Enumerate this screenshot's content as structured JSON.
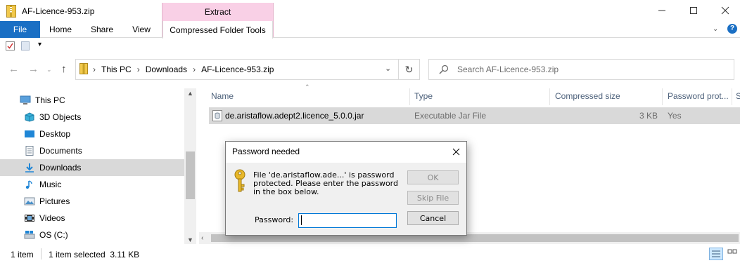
{
  "window": {
    "title": "AF-Licence-953.zip"
  },
  "ribbon": {
    "context_group": "Extract",
    "tabs": [
      "File",
      "Home",
      "Share",
      "View",
      "Compressed Folder Tools"
    ]
  },
  "address_bar": {
    "crumbs": [
      "This PC",
      "Downloads",
      "AF-Licence-953.zip"
    ],
    "search_placeholder": "Search AF-Licence-953.zip"
  },
  "nav_pane": {
    "items": [
      {
        "label": "This PC",
        "icon": "computer-icon"
      },
      {
        "label": "3D Objects",
        "icon": "cube-icon"
      },
      {
        "label": "Desktop",
        "icon": "desktop-icon"
      },
      {
        "label": "Documents",
        "icon": "document-icon"
      },
      {
        "label": "Downloads",
        "icon": "download-icon"
      },
      {
        "label": "Music",
        "icon": "music-icon"
      },
      {
        "label": "Pictures",
        "icon": "pictures-icon"
      },
      {
        "label": "Videos",
        "icon": "video-icon"
      },
      {
        "label": "OS (C:)",
        "icon": "drive-icon"
      }
    ]
  },
  "file_list": {
    "columns": [
      "Name",
      "Type",
      "Compressed size",
      "Password prot...",
      "S"
    ],
    "rows": [
      {
        "name": "de.aristaflow.adept2.licence_5.0.0.jar",
        "type": "Executable Jar File",
        "compressed_size": "3 KB",
        "password_protected": "Yes"
      }
    ]
  },
  "status_bar": {
    "item_count": "1 item",
    "selection": "1 item selected  3.11 KB"
  },
  "dialog": {
    "title": "Password needed",
    "message": "File 'de.aristaflow.ade...' is password protected. Please enter the password in the box below.",
    "ok_label": "OK",
    "skip_label": "Skip File",
    "cancel_label": "Cancel",
    "password_label": "Password:",
    "password_value": ""
  },
  "colors": {
    "file_tab": "#1a6fc4",
    "extract_tab": "#f9d0e6",
    "selected_row": "#d9d9d9",
    "input_focus": "#0078d7"
  }
}
